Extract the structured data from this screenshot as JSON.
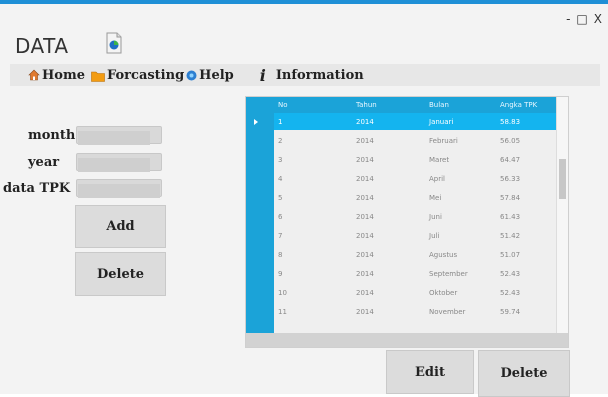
{
  "window": {
    "title": "DATA",
    "controls": {
      "minimize": "-",
      "maximize": "□",
      "close": "X"
    }
  },
  "menu": {
    "home": "Home",
    "forcasting": "Forcasting",
    "help": "Help",
    "info_glyph": "i",
    "information": "Information"
  },
  "form": {
    "month_label": "month",
    "year_label": "year",
    "tpk_label": "data TPK",
    "month_value": "",
    "year_value": "",
    "tpk_value": "",
    "add_label": "Add",
    "delete_label": "Delete"
  },
  "grid": {
    "headers": [
      "No",
      "Tahun",
      "Bulan",
      "Angka TPK"
    ],
    "rows": [
      {
        "no": "1",
        "tahun": "2014",
        "bulan": "Januari",
        "tpk": "58.83"
      },
      {
        "no": "2",
        "tahun": "2014",
        "bulan": "Februari",
        "tpk": "56.05"
      },
      {
        "no": "3",
        "tahun": "2014",
        "bulan": "Maret",
        "tpk": "64.47"
      },
      {
        "no": "4",
        "tahun": "2014",
        "bulan": "April",
        "tpk": "56.33"
      },
      {
        "no": "5",
        "tahun": "2014",
        "bulan": "Mei",
        "tpk": "57.84"
      },
      {
        "no": "6",
        "tahun": "2014",
        "bulan": "Juni",
        "tpk": "61.43"
      },
      {
        "no": "7",
        "tahun": "2014",
        "bulan": "Juli",
        "tpk": "51.42"
      },
      {
        "no": "8",
        "tahun": "2014",
        "bulan": "Agustus",
        "tpk": "51.07"
      },
      {
        "no": "9",
        "tahun": "2014",
        "bulan": "September",
        "tpk": "52.43"
      },
      {
        "no": "10",
        "tahun": "2014",
        "bulan": "Oktober",
        "tpk": "52.43"
      },
      {
        "no": "11",
        "tahun": "2014",
        "bulan": "November",
        "tpk": "59.74"
      }
    ],
    "selected_row": 1
  },
  "actions": {
    "edit_label": "Edit",
    "delete_label": "Delete"
  },
  "colors": {
    "accent": "#1ba3d8",
    "selection": "#14b4ef",
    "window_border": "#1e8fd6"
  }
}
